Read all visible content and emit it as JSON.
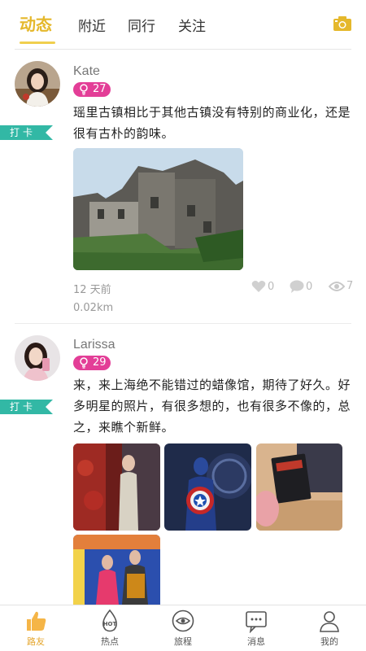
{
  "tabs": [
    {
      "label": "动态",
      "active": true
    },
    {
      "label": "附近"
    },
    {
      "label": "同行"
    },
    {
      "label": "关注"
    }
  ],
  "colors": {
    "accent": "#e5b82c",
    "level_badge": "#e33e97",
    "checkin_tag": "#32b8a5"
  },
  "posts": [
    {
      "username": "Kate",
      "level": "27",
      "tag": "打卡",
      "content": "瑶里古镇相比于其他古镇没有特别的商业化，还是很有古朴的韵味。",
      "time": "12 天前",
      "distance": "0.02km",
      "likes": "0",
      "comments": "0",
      "views": "7"
    },
    {
      "username": "Larissa",
      "level": "29",
      "tag": "打卡",
      "content": "来，来上海绝不能错过的蜡像馆，期待了好久。好多明星的照片，有很多想的，也有很多不像的，总之，来瞧个新鲜。"
    }
  ],
  "nav": [
    {
      "label": "路友",
      "icon": "thumbs-up-icon",
      "active": true
    },
    {
      "label": "热点",
      "icon": "hot-icon"
    },
    {
      "label": "旅程",
      "icon": "journey-icon"
    },
    {
      "label": "消息",
      "icon": "message-icon"
    },
    {
      "label": "我的",
      "icon": "profile-icon"
    }
  ]
}
